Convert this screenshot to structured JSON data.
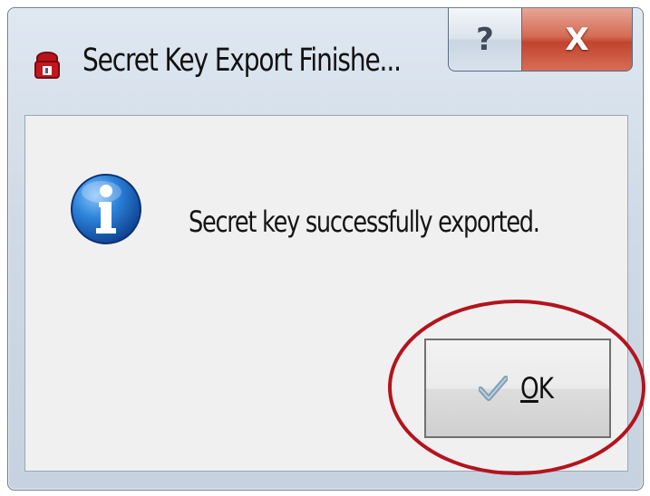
{
  "window": {
    "title": "Secret Key Export Finishe...",
    "app_icon": "lock-icon",
    "buttons": {
      "help_label": "?",
      "close_label": "X"
    }
  },
  "dialog": {
    "icon": "info-icon",
    "message": "Secret key successfully exported.",
    "ok_button": {
      "label": "OK",
      "icon": "checkmark-icon"
    }
  },
  "annotation": {
    "shape": "ellipse",
    "color": "#b3141d",
    "target": "ok-button"
  },
  "colors": {
    "close_button": "#c1442d",
    "info_icon": "#1f73c7"
  }
}
